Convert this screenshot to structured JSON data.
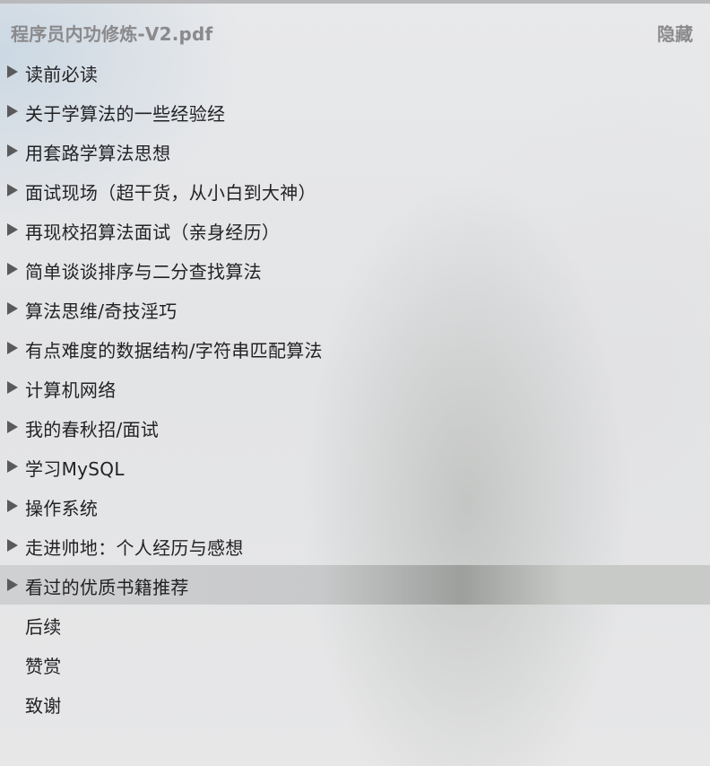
{
  "header": {
    "title": "程序员内功修炼-V2.pdf",
    "hide_label": "隐藏"
  },
  "colors": {
    "text": "#222224",
    "header_text": "#8a8a8c",
    "selected_row": "#c8c9ca"
  },
  "toc": {
    "items": [
      {
        "label": "读前必读",
        "expandable": true,
        "selected": false
      },
      {
        "label": "关于学算法的一些经验经",
        "expandable": true,
        "selected": false
      },
      {
        "label": "用套路学算法思想",
        "expandable": true,
        "selected": false
      },
      {
        "label": "面试现场（超干货，从小白到大神）",
        "expandable": true,
        "selected": false
      },
      {
        "label": "再现校招算法面试（亲身经历）",
        "expandable": true,
        "selected": false
      },
      {
        "label": "简单谈谈排序与二分查找算法",
        "expandable": true,
        "selected": false
      },
      {
        "label": "算法思维/奇技淫巧",
        "expandable": true,
        "selected": false
      },
      {
        "label": "有点难度的数据结构/字符串匹配算法",
        "expandable": true,
        "selected": false
      },
      {
        "label": "计算机网络",
        "expandable": true,
        "selected": false
      },
      {
        "label": "我的春秋招/面试",
        "expandable": true,
        "selected": false
      },
      {
        "label": "学习MySQL",
        "expandable": true,
        "selected": false
      },
      {
        "label": "操作系统",
        "expandable": true,
        "selected": false
      },
      {
        "label": "走进帅地：个人经历与感想",
        "expandable": true,
        "selected": false
      },
      {
        "label": "看过的优质书籍推荐",
        "expandable": true,
        "selected": true
      },
      {
        "label": "后续",
        "expandable": false,
        "selected": false
      },
      {
        "label": "赞赏",
        "expandable": false,
        "selected": false
      },
      {
        "label": "致谢",
        "expandable": false,
        "selected": false
      }
    ]
  }
}
